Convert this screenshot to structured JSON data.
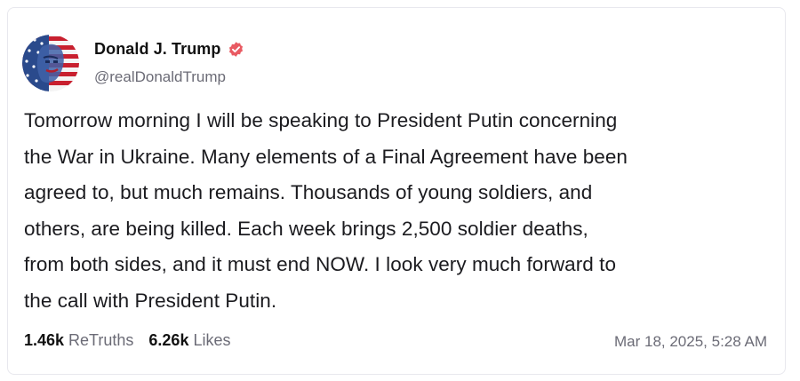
{
  "post": {
    "author": {
      "display_name": "Donald J. Trump",
      "handle": "@realDonaldTrump",
      "verified": true,
      "verified_color": "#e95a62",
      "avatar_icon": "american-flag-portrait"
    },
    "text": "Tomorrow morning I will be speaking to President Putin concerning\nthe War in Ukraine. Many elements of a Final Agreement have been\nagreed to, but much remains. Thousands of young soldiers, and\nothers, are being killed. Each week brings 2,500 soldier deaths,\nfrom both sides, and it must end NOW. I look very much forward to\nthe call with President Putin.",
    "stats": {
      "retruths_count": "1.46k",
      "retruths_label": "ReTruths",
      "likes_count": "6.26k",
      "likes_label": "Likes"
    },
    "timestamp": "Mar 18, 2025, 5:28 AM"
  },
  "colors": {
    "text_primary": "#111111",
    "text_secondary": "#6b6b76",
    "card_border": "#e8e8ee"
  }
}
